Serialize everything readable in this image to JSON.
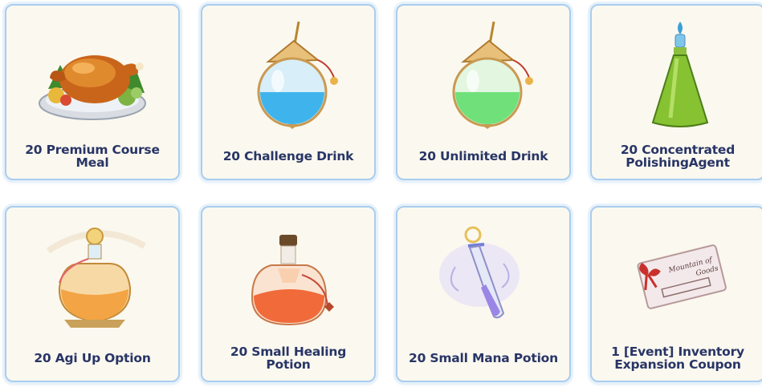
{
  "rewards": [
    {
      "label": "20 Premium Course Meal",
      "icon": "roast-turkey-meal-icon"
    },
    {
      "label": "20 Challenge Drink",
      "icon": "blue-potion-flask-icon"
    },
    {
      "label": "20 Unlimited Drink",
      "icon": "green-potion-flask-icon"
    },
    {
      "label": "20 Concentrated PolishingAgent",
      "icon": "green-conical-flask-icon"
    },
    {
      "label": "20 Agi Up Option",
      "icon": "golden-potion-bottle-icon"
    },
    {
      "label": "20 Small Healing Potion",
      "icon": "red-potion-bottle-icon"
    },
    {
      "label": "20 Small Mana Potion",
      "icon": "purple-mana-vial-icon"
    },
    {
      "label": "1 [Event] Inventory Expansion Coupon",
      "icon": "coupon-ticket-icon"
    }
  ],
  "coupon_art": {
    "line1": "Mountain of",
    "line2": "Goods"
  }
}
